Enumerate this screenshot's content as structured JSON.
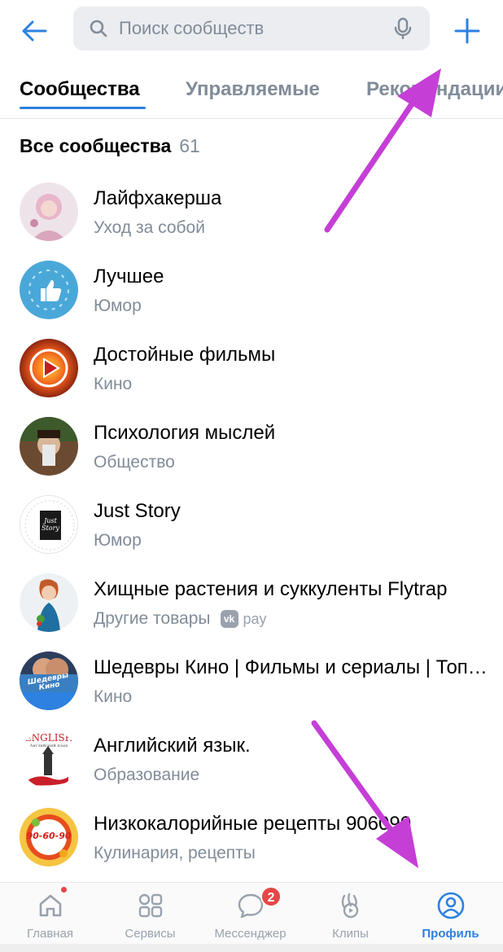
{
  "search": {
    "placeholder": "Поиск сообществ"
  },
  "tabs": [
    {
      "label": "Сообщества",
      "active": true
    },
    {
      "label": "Управляемые",
      "active": false
    },
    {
      "label": "Рекомендации",
      "active": false
    }
  ],
  "section": {
    "title": "Все сообщества",
    "count": "61"
  },
  "communities": [
    {
      "name": "Лайфхакерша",
      "category": "Уход за собой"
    },
    {
      "name": "Лучшее",
      "category": "Юмор"
    },
    {
      "name": "Достойные фильмы",
      "category": "Кино"
    },
    {
      "name": "Психология мыслей",
      "category": "Общество"
    },
    {
      "name": "Just Story",
      "category": "Юмор"
    },
    {
      "name": "Хищные растения и суккуленты Flytrap",
      "category": "Другие товары",
      "pay_label": "pay"
    },
    {
      "name": "Шедевры Кино | Фильмы и сериалы | Топ фильмов",
      "category": "Кино"
    },
    {
      "name": "Английский язык.",
      "category": "Образование"
    },
    {
      "name": "Низкокалорийные рецепты 906090",
      "category": "Кулинария, рецепты"
    }
  ],
  "avatar_texts": {
    "just_story": "Just Story",
    "shedevry": "Шедевры Кино",
    "english": "ENGLISH",
    "english_sub": "Английский язык",
    "recipes": "90-60-90"
  },
  "bottom_nav": [
    {
      "label": "Главная",
      "icon": "home-icon",
      "dot": true
    },
    {
      "label": "Сервисы",
      "icon": "services-icon"
    },
    {
      "label": "Мессенджер",
      "icon": "messenger-icon",
      "badge": "2"
    },
    {
      "label": "Клипы",
      "icon": "clips-icon"
    },
    {
      "label": "Профиль",
      "icon": "profile-icon",
      "active": true
    }
  ],
  "colors": {
    "accent": "#2d81e0",
    "secondary_text": "#818c99",
    "badge": "#e64646",
    "annotation_arrow": "#c53fd6"
  }
}
